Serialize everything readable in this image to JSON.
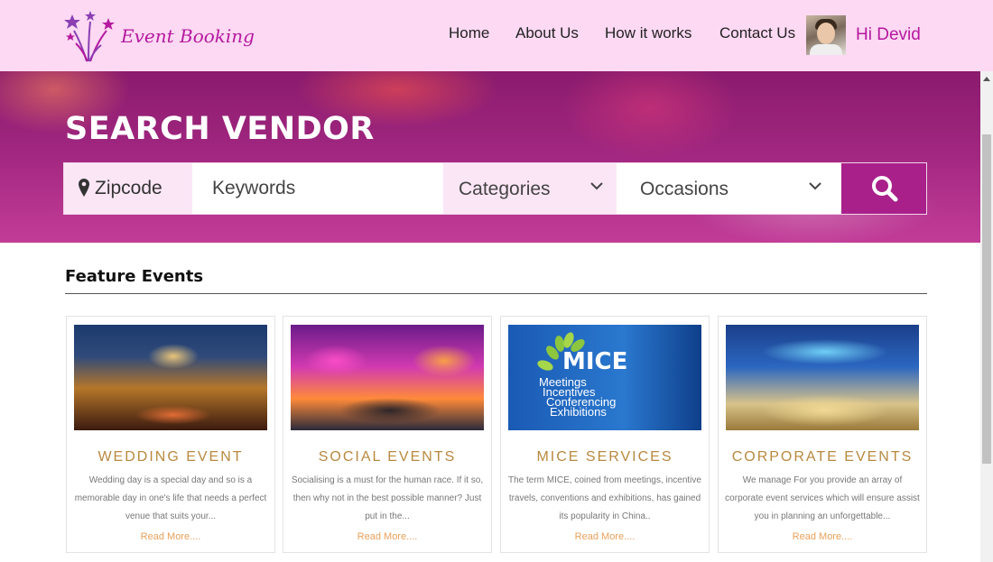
{
  "brand": {
    "name": "Event Booking",
    "accent": "#b5189f",
    "header_bg": "#fdd9f3"
  },
  "nav": [
    {
      "label": "Home"
    },
    {
      "label": "About Us"
    },
    {
      "label": "How it works"
    },
    {
      "label": "Contact Us"
    }
  ],
  "user": {
    "greeting": "Hi Devid",
    "avatar": "user-avatar"
  },
  "hero": {
    "title": "SEARCH VENDOR",
    "zip_label": "Zipcode",
    "zip_icon": "map-pin-icon",
    "keywords_placeholder": "Keywords",
    "categories_label": "Categories",
    "occasions_label": "Occasions",
    "search_icon": "search-icon",
    "button_color": "#a9208a"
  },
  "features": {
    "title": "Feature Events",
    "cards": [
      {
        "title": "WEDDING EVENT",
        "description": "Wedding day is a special day and so is a memorable day in one's life that needs a perfect venue that suits your...",
        "link": "Read More....",
        "image": "wedding-venue-photo"
      },
      {
        "title": "SOCIAL EVENTS",
        "description": "Socialising is a must for the human race. If it so, then why not in the best possible manner? Just put in the...",
        "link": "Read More....",
        "image": "social-party-photo"
      },
      {
        "title": "MICE SERVICES",
        "description": "The term MICE, coined from meetings, incentive travels, conventions and exhibitions, has gained its popularity in China..",
        "link": "Read More....",
        "image": "mice-banner-photo",
        "image_text": {
          "headline": "MICE",
          "lines": [
            "Meetings",
            "Incentives",
            "Conferencing",
            "Exhibitions"
          ]
        }
      },
      {
        "title": "CORPORATE EVENTS",
        "description": "We manage For you provide an array of corporate event services which will ensure assist you in planning an unforgettable...",
        "link": "Read More....",
        "image": "corporate-hall-photo"
      }
    ]
  }
}
